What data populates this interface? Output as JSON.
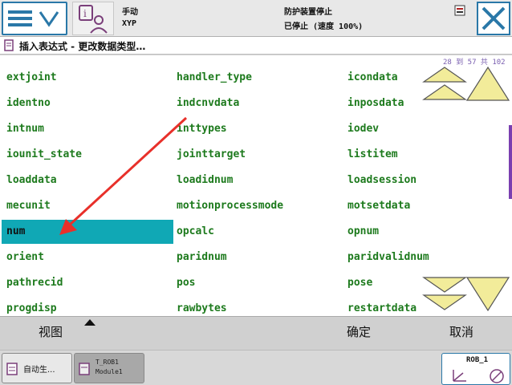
{
  "topbar": {
    "mode": "手动",
    "system": "XYP",
    "status": "防护装置停止",
    "state": "已停止 (速度 100%)"
  },
  "title": "插入表达式 - 更改数据类型…",
  "pager": "28 到 57 共 102",
  "columns": [
    [
      "extjoint",
      "identno",
      "intnum",
      "iounit_state",
      "loaddata",
      "mecunit",
      "num",
      "orient",
      "pathrecid",
      "progdisp"
    ],
    [
      "handler_type",
      "indcnvdata",
      "inttypes",
      "jointtarget",
      "loadidnum",
      "motionprocessmode",
      "opcalc",
      "paridnum",
      "pos",
      "rawbytes"
    ],
    [
      "icondata",
      "inposdata",
      "iodev",
      "listitem",
      "loadsession",
      "motsetdata",
      "opnum",
      "paridvalidnum",
      "pose",
      "restartdata"
    ]
  ],
  "selected": "num",
  "actions": {
    "view": "视图",
    "ok": "确定",
    "cancel": "取消"
  },
  "taskbar": {
    "task1": "自动生...",
    "task2_line1": "T_ROB1",
    "task2_line2": "Module1",
    "robot": "ROB_1"
  },
  "colors": {
    "accent": "#2a78a8",
    "selection": "#10a8b5",
    "item_text": "#1d7a1d",
    "arrow_fill": "#f2ec9a"
  },
  "icons": [
    "menu-icon",
    "chevron-down-icon",
    "info-icon",
    "close-icon",
    "scroll-up-icon",
    "scroll-down-icon",
    "caret-up-icon",
    "robot-axes-icon"
  ]
}
